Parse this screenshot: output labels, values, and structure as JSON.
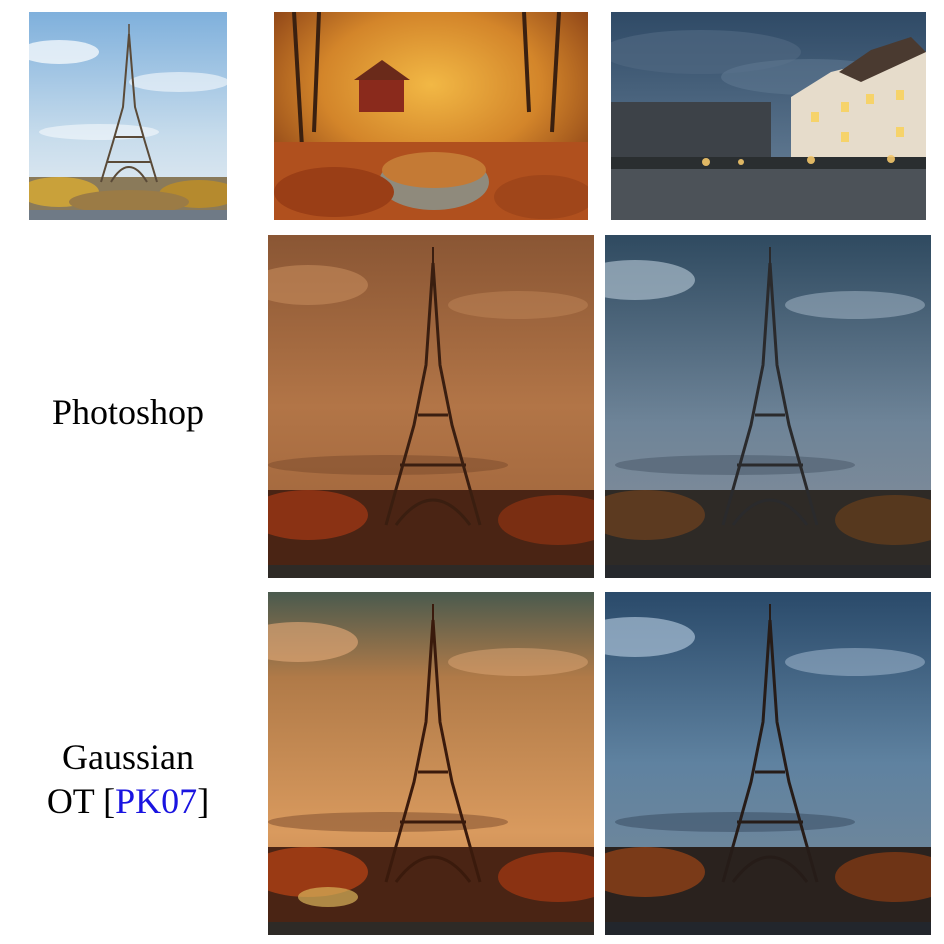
{
  "labels": {
    "photoshop": "Photoshop",
    "gaussian_line1": "Gaussian",
    "gaussian_ot": "OT",
    "gaussian_bracket_open": "[",
    "gaussian_cite": "PK07",
    "gaussian_bracket_close": "]"
  },
  "colors": {
    "citation": "#1a14e0",
    "autumn_tint": "#c97a3c",
    "dusk_tint": "#3f5f7a",
    "sky_day": "#a9c8e4"
  }
}
